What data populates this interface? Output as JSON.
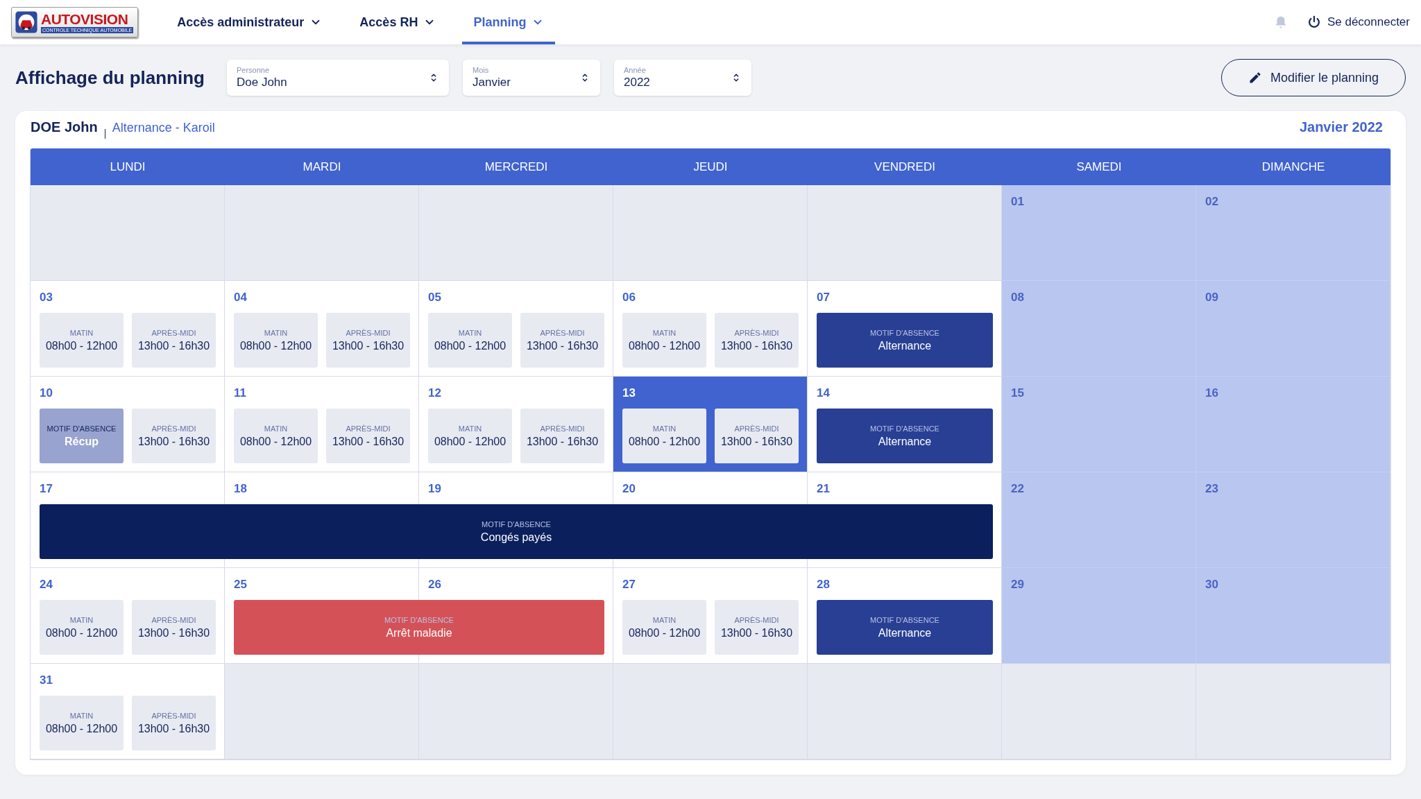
{
  "header": {
    "logo": {
      "title": "AUTOVISION",
      "subtitle": "CONTROLE TECHNIQUE AUTOMOBILE"
    },
    "nav": [
      {
        "label": "Accès administrateur",
        "selected": false
      },
      {
        "label": "Accès RH",
        "selected": false
      },
      {
        "label": "Planning",
        "selected": true
      }
    ],
    "logout": "Se déconnecter"
  },
  "toolbar": {
    "title": "Affichage du planning",
    "selects": [
      {
        "label": "Personne",
        "value": "Doe John"
      },
      {
        "label": "Mois",
        "value": "Janvier"
      },
      {
        "label": "Année",
        "value": "2022"
      }
    ],
    "edit_button": "Modifier le planning"
  },
  "planning": {
    "name": "DOE John",
    "contract": "Alternance - Karoil",
    "month": "Janvier 2022",
    "weekdays": [
      "LUNDI",
      "MARDI",
      "MERCREDI",
      "JEUDI",
      "VENDREDI",
      "SAMEDI",
      "DIMANCHE"
    ],
    "weeks": [
      {
        "days": [
          {
            "kind": "blank",
            "selected": false
          },
          {
            "kind": "blank",
            "selected": false
          },
          {
            "kind": "blank",
            "selected": false
          },
          {
            "kind": "blank",
            "selected": false
          },
          {
            "kind": "blank",
            "selected": false
          },
          {
            "kind": "weekend",
            "day": "01",
            "selected": false
          },
          {
            "kind": "weekend",
            "day": "02",
            "selected": false
          }
        ]
      },
      {
        "days": [
          {
            "kind": "weekday",
            "day": "03",
            "selected": false,
            "entries": [
              {
                "kind": "slot",
                "label": "MATIN",
                "hours": "08h00 - 12h00"
              },
              {
                "kind": "slot",
                "label": "APRÈS-MIDI",
                "hours": "13h00 - 16h30"
              }
            ]
          },
          {
            "kind": "weekday",
            "day": "04",
            "selected": false,
            "entries": [
              {
                "kind": "slot",
                "label": "MATIN",
                "hours": "08h00 - 12h00"
              },
              {
                "kind": "slot",
                "label": "APRÈS-MIDI",
                "hours": "13h00 - 16h30"
              }
            ]
          },
          {
            "kind": "weekday",
            "day": "05",
            "selected": false,
            "entries": [
              {
                "kind": "slot",
                "label": "MATIN",
                "hours": "08h00 - 12h00"
              },
              {
                "kind": "slot",
                "label": "APRÈS-MIDI",
                "hours": "13h00 - 16h30"
              }
            ]
          },
          {
            "kind": "weekday",
            "day": "06",
            "selected": false,
            "entries": [
              {
                "kind": "slot",
                "label": "MATIN",
                "hours": "08h00 - 12h00"
              },
              {
                "kind": "slot",
                "label": "APRÈS-MIDI",
                "hours": "13h00 - 16h30"
              }
            ]
          },
          {
            "kind": "weekday",
            "day": "07",
            "selected": false,
            "entries": [
              {
                "kind": "absence",
                "label": "MOTIF D'ABSENCE",
                "reason": "Alternance",
                "color": "#283f94"
              }
            ]
          },
          {
            "kind": "weekend",
            "day": "08",
            "selected": false
          },
          {
            "kind": "weekend",
            "day": "09",
            "selected": false
          }
        ]
      },
      {
        "days": [
          {
            "kind": "weekday",
            "day": "10",
            "selected": false,
            "entries": [
              {
                "kind": "absence",
                "label": "MOTIF D'ABSENCE",
                "reason": "Récup",
                "color": "#98a3cf"
              },
              {
                "kind": "slot",
                "label": "APRÈS-MIDI",
                "hours": "13h00 - 16h30"
              }
            ]
          },
          {
            "kind": "weekday",
            "day": "11",
            "selected": false,
            "entries": [
              {
                "kind": "slot",
                "label": "MATIN",
                "hours": "08h00 - 12h00"
              },
              {
                "kind": "slot",
                "label": "APRÈS-MIDI",
                "hours": "13h00 - 16h30"
              }
            ]
          },
          {
            "kind": "weekday",
            "day": "12",
            "selected": false,
            "entries": [
              {
                "kind": "slot",
                "label": "MATIN",
                "hours": "08h00 - 12h00"
              },
              {
                "kind": "slot",
                "label": "APRÈS-MIDI",
                "hours": "13h00 - 16h30"
              }
            ]
          },
          {
            "kind": "weekday",
            "day": "13",
            "selected": true,
            "entries": [
              {
                "kind": "slot",
                "label": "MATIN",
                "hours": "08h00 - 12h00"
              },
              {
                "kind": "slot",
                "label": "APRÈS-MIDI",
                "hours": "13h00 - 16h30"
              }
            ]
          },
          {
            "kind": "weekday",
            "day": "14",
            "selected": false,
            "entries": [
              {
                "kind": "absence",
                "label": "MOTIF D'ABSENCE",
                "reason": "Alternance",
                "color": "#283f94"
              }
            ]
          },
          {
            "kind": "weekend",
            "day": "15",
            "selected": false
          },
          {
            "kind": "weekend",
            "day": "16",
            "selected": false
          }
        ]
      },
      {
        "days": [
          {
            "kind": "weekday",
            "day": "17",
            "selected": false,
            "entries": [
              {
                "kind": "absence",
                "label": "MOTIF D'ABSENCE",
                "reason": "Congés payés",
                "color": "#0a1f5c"
              }
            ]
          },
          {
            "kind": "weekday",
            "day": "18",
            "selected": false
          },
          {
            "kind": "weekday",
            "day": "19",
            "selected": false
          },
          {
            "kind": "weekday",
            "day": "20",
            "selected": false
          },
          {
            "kind": "weekday",
            "day": "21",
            "selected": false
          },
          {
            "kind": "weekend",
            "day": "22",
            "selected": false
          },
          {
            "kind": "weekend",
            "day": "23",
            "selected": false
          }
        ]
      },
      {
        "days": [
          {
            "kind": "weekday",
            "day": "24",
            "selected": false,
            "entries": [
              {
                "kind": "slot",
                "label": "MATIN",
                "hours": "08h00 - 12h00"
              },
              {
                "kind": "slot",
                "label": "APRÈS-MIDI",
                "hours": "13h00 - 16h30"
              }
            ]
          },
          {
            "kind": "weekday",
            "day": "25",
            "selected": false,
            "entries": [
              {
                "kind": "absence",
                "label": "MOTIF D'ABSENCE",
                "reason": "Arrêt maladie",
                "color": "#d45257"
              }
            ]
          },
          {
            "kind": "weekday",
            "day": "26",
            "selected": false
          },
          {
            "kind": "weekday",
            "day": "27",
            "selected": false,
            "entries": [
              {
                "kind": "slot",
                "label": "MATIN",
                "hours": "08h00 - 12h00"
              },
              {
                "kind": "slot",
                "label": "APRÈS-MIDI",
                "hours": "13h00 - 16h30"
              }
            ]
          },
          {
            "kind": "weekday",
            "day": "28",
            "selected": false,
            "entries": [
              {
                "kind": "absence",
                "label": "MOTIF D'ABSENCE",
                "reason": "Alternance",
                "color": "#283f94"
              }
            ]
          },
          {
            "kind": "weekend",
            "day": "29",
            "selected": false
          },
          {
            "kind": "weekend",
            "day": "30",
            "selected": false
          }
        ]
      },
      {
        "days": [
          {
            "kind": "weekday",
            "day": "31",
            "selected": false,
            "entries": [
              {
                "kind": "slot",
                "label": "MATIN",
                "hours": "08h00 - 12h00"
              },
              {
                "kind": "slot",
                "label": "APRÈS-MIDI",
                "hours": "13h00 - 16h30"
              }
            ]
          },
          {
            "kind": "blank",
            "selected": false
          },
          {
            "kind": "blank",
            "selected": false
          },
          {
            "kind": "blank",
            "selected": false
          },
          {
            "kind": "blank",
            "selected": false
          },
          {
            "kind": "blank",
            "selected": false
          },
          {
            "kind": "blank",
            "selected": false
          }
        ]
      }
    ]
  }
}
